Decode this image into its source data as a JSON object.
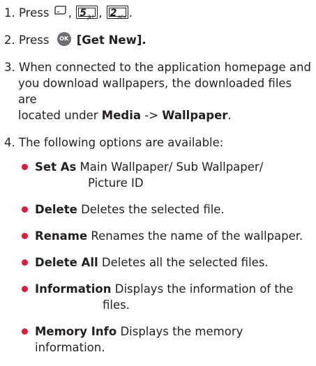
{
  "steps": {
    "s1": {
      "number": "1.",
      "prefix": "Press",
      "keys": [
        {
          "icon": "menu-softkey-icon"
        },
        {
          "digit": "5",
          "letters": "jkl"
        },
        {
          "digit": "2",
          "letters": "abc"
        }
      ]
    },
    "s2": {
      "number": "2.",
      "prefix": "Press",
      "ok_icon_label": "OK",
      "action": "[Get New]."
    },
    "s3": {
      "number": "3.",
      "line1": "When connected to the application homepage and",
      "line2": "you download wallpapers, the downloaded files are",
      "line3_prefix": "located under",
      "path_a": "Media",
      "path_sep": "->",
      "path_b": "Wallpaper",
      "period": "."
    },
    "s4": {
      "number": "4.",
      "text": "The following options are available:"
    }
  },
  "options": [
    {
      "term": "Set As",
      "desc": "Main Wallpaper/ Sub Wallpaper/",
      "desc2": "Picture ID"
    },
    {
      "term": "Delete",
      "desc": "Deletes the selected file."
    },
    {
      "term": "Rename",
      "desc": "Renames the name of the wallpaper."
    },
    {
      "term": "Delete All",
      "desc": "Deletes all the selected files."
    },
    {
      "term": "Information",
      "desc": "Displays the information of the",
      "desc2": "files."
    },
    {
      "term": "Memory Info",
      "desc": "Displays the memory information."
    }
  ],
  "colors": {
    "text": "#231f20",
    "bullet": "#e31937",
    "ok_icon": "#6d6e71"
  }
}
